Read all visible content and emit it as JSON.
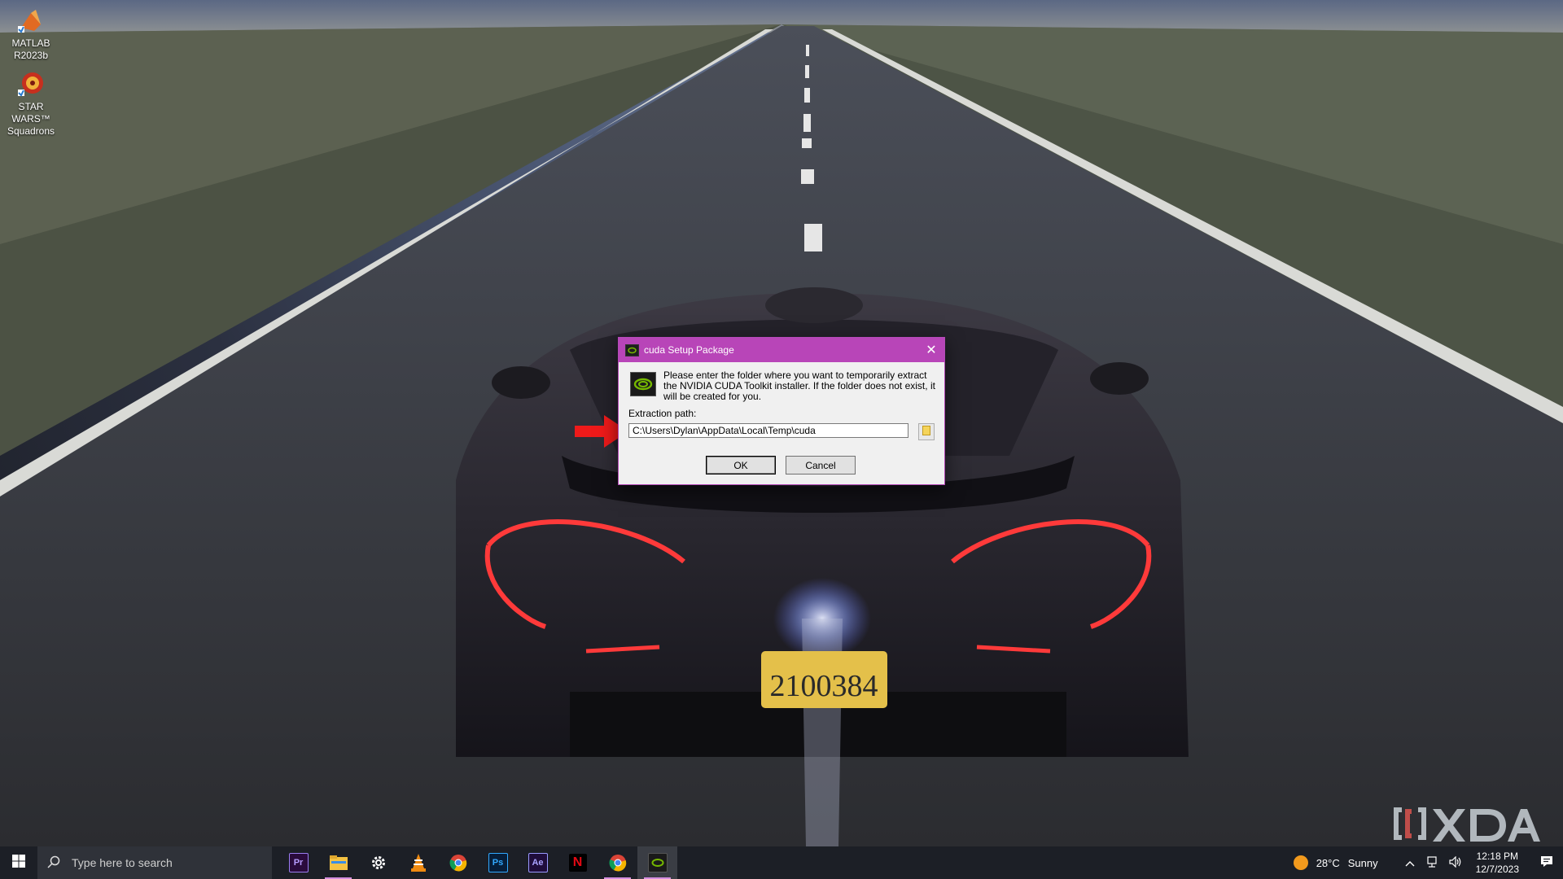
{
  "desktop": {
    "icons": [
      {
        "label_line1": "MATLAB",
        "label_line2": "R2023b",
        "icon": "matlab-icon"
      },
      {
        "label_line1": "STAR WARS™",
        "label_line2": "Squadrons",
        "icon": "star-wars-squadrons-icon"
      }
    ]
  },
  "dialog": {
    "title": "cuda Setup Package",
    "message": "Please enter the folder where you want to temporarily extract the NVIDIA CUDA Toolkit installer. If the folder does not exist, it will be created for you.",
    "path_label": "Extraction path:",
    "path_value": "C:\\Users\\Dylan\\AppData\\Local\\Temp\\cuda",
    "ok_label": "OK",
    "cancel_label": "Cancel",
    "accent_color": "#b845b8"
  },
  "watermark": {
    "text": "XDA"
  },
  "taskbar": {
    "search_placeholder": "Type here to search",
    "apps": [
      {
        "name": "premiere-pro",
        "label": "Pr"
      },
      {
        "name": "file-explorer",
        "label": ""
      },
      {
        "name": "settings",
        "label": ""
      },
      {
        "name": "vlc",
        "label": ""
      },
      {
        "name": "chrome",
        "label": ""
      },
      {
        "name": "photoshop",
        "label": "Ps"
      },
      {
        "name": "after-effects",
        "label": "Ae"
      },
      {
        "name": "netflix",
        "label": "N"
      },
      {
        "name": "chrome-2",
        "label": ""
      },
      {
        "name": "nvidia-installer",
        "label": ""
      }
    ],
    "weather": {
      "temp": "28°C",
      "condition": "Sunny"
    },
    "clock": {
      "time": "12:18 PM",
      "date": "12/7/2023"
    }
  }
}
